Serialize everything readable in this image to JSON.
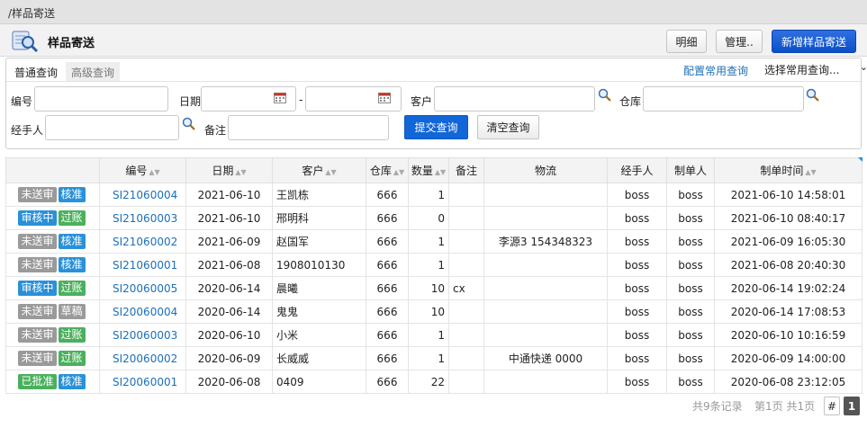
{
  "breadcrumb": "/样品寄送",
  "page": {
    "title": "样品寄送",
    "buttons": {
      "detail": "明细",
      "manage": "管理..",
      "add": "新增样品寄送"
    }
  },
  "search": {
    "tab_normal": "普通查询",
    "tab_advanced": "高级查询",
    "config_link": "配置常用查询",
    "select_common": "选择常用查询...",
    "fields": {
      "code": "编号",
      "date": "日期",
      "date_sep": "-",
      "customer": "客户",
      "warehouse": "仓库",
      "handler": "经手人",
      "remark": "备注"
    },
    "submit": "提交查询",
    "clear": "清空查询"
  },
  "colors": {
    "badge_gray": "#9a9a9a",
    "badge_blue": "#2a91d8",
    "badge_green": "#4bb05d",
    "link": "#1d6fb8",
    "primary": "#0b4fc9"
  },
  "table": {
    "columns": [
      "",
      "编号",
      "日期",
      "客户",
      "仓库",
      "数量",
      "备注",
      "物流",
      "经手人",
      "制单人",
      "制单时间"
    ],
    "sortable": [
      false,
      true,
      true,
      true,
      true,
      true,
      false,
      false,
      false,
      false,
      true
    ],
    "rows": [
      {
        "badges": [
          [
            "未送审",
            "gray"
          ],
          [
            "核准",
            "blue"
          ]
        ],
        "code": "SI21060004",
        "date": "2021-06-10",
        "customer": "王凯栋",
        "warehouse": "666",
        "qty": "1",
        "remark": "",
        "logistics": "",
        "handler": "boss",
        "creator": "boss",
        "created": "2021-06-10 14:58:01"
      },
      {
        "badges": [
          [
            "审核中",
            "blue"
          ],
          [
            "过账",
            "green"
          ]
        ],
        "code": "SI21060003",
        "date": "2021-06-10",
        "customer": "邢明科",
        "warehouse": "666",
        "qty": "0",
        "remark": "",
        "logistics": "",
        "handler": "boss",
        "creator": "boss",
        "created": "2021-06-10 08:40:17"
      },
      {
        "badges": [
          [
            "未送审",
            "gray"
          ],
          [
            "核准",
            "blue"
          ]
        ],
        "code": "SI21060002",
        "date": "2021-06-09",
        "customer": "赵国军",
        "warehouse": "666",
        "qty": "1",
        "remark": "",
        "logistics": "李源3 154348323",
        "handler": "boss",
        "creator": "boss",
        "created": "2021-06-09 16:05:30"
      },
      {
        "badges": [
          [
            "未送审",
            "gray"
          ],
          [
            "核准",
            "blue"
          ]
        ],
        "code": "SI21060001",
        "date": "2021-06-08",
        "customer": "1908010130",
        "warehouse": "666",
        "qty": "1",
        "remark": "",
        "logistics": "",
        "handler": "boss",
        "creator": "boss",
        "created": "2021-06-08 20:40:30"
      },
      {
        "badges": [
          [
            "审核中",
            "blue"
          ],
          [
            "过账",
            "green"
          ]
        ],
        "code": "SI20060005",
        "date": "2020-06-14",
        "customer": "晨曦",
        "warehouse": "666",
        "qty": "10",
        "remark": "cx",
        "logistics": "",
        "handler": "boss",
        "creator": "boss",
        "created": "2020-06-14 19:02:24"
      },
      {
        "badges": [
          [
            "未送审",
            "gray"
          ],
          [
            "草稿",
            "gray"
          ]
        ],
        "code": "SI20060004",
        "date": "2020-06-14",
        "customer": "鬼鬼",
        "warehouse": "666",
        "qty": "10",
        "remark": "",
        "logistics": "",
        "handler": "boss",
        "creator": "boss",
        "created": "2020-06-14 17:08:53"
      },
      {
        "badges": [
          [
            "未送审",
            "gray"
          ],
          [
            "过账",
            "green"
          ]
        ],
        "code": "SI20060003",
        "date": "2020-06-10",
        "customer": "小米",
        "warehouse": "666",
        "qty": "1",
        "remark": "",
        "logistics": "",
        "handler": "boss",
        "creator": "boss",
        "created": "2020-06-10 10:16:59"
      },
      {
        "badges": [
          [
            "未送审",
            "gray"
          ],
          [
            "过账",
            "green"
          ]
        ],
        "code": "SI20060002",
        "date": "2020-06-09",
        "customer": "长威威",
        "warehouse": "666",
        "qty": "1",
        "remark": "",
        "logistics": "中通快递 0000",
        "handler": "boss",
        "creator": "boss",
        "created": "2020-06-09 14:00:00"
      },
      {
        "badges": [
          [
            "已批准",
            "green"
          ],
          [
            "核准",
            "blue"
          ]
        ],
        "code": "SI20060001",
        "date": "2020-06-08",
        "customer": "0409",
        "warehouse": "666",
        "qty": "22",
        "remark": "",
        "logistics": "",
        "handler": "boss",
        "creator": "boss",
        "created": "2020-06-08 23:12:05"
      }
    ]
  },
  "pager": {
    "total": "共9条记录",
    "page_info": "第1页 共1页",
    "hash": "#",
    "current": "1"
  }
}
